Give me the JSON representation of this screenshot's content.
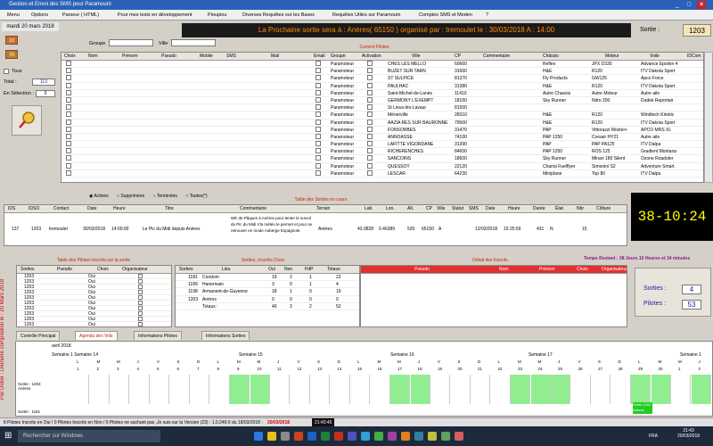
{
  "window": {
    "title": "Gestion et Envoi des SMS pour Paramoum",
    "min": "_",
    "max": "□",
    "close": "✕"
  },
  "menu": [
    "Menu",
    "Options",
    "Parseur ( HTML)",
    "Pour mes tests en développement",
    "Pioupiou",
    "Diverses Requêtes sur les Bases",
    "Requêtes Utiles sur Paramoum",
    "Comptes SMS et Moden",
    "?"
  ],
  "left": {
    "date": "mardi 20 mars 2018",
    "num1": "10",
    "num2": "79",
    "tous_label": "Tous",
    "total_label": "Total :",
    "total": "113",
    "selection_label": "En Sélection :",
    "selection": "0"
  },
  "filters": {
    "groupe_label": "Groupe",
    "ville_label": "Ville"
  },
  "banner": "La Prochaine sortie sera  à : Anères( 65150 ) organisé par : tremoulet le : 30/03/2018 A : 14:00",
  "sortie": {
    "label": "Sortie :",
    "value": "1203"
  },
  "pilots": {
    "title": "Current Pilotes",
    "headers": [
      "Choix",
      "Nom",
      "Prénom",
      "Pseudo",
      "Mobile",
      "SMS",
      "Mail",
      "Email",
      "Groupe",
      "Activation",
      "Ville",
      "CP",
      "Commentaire",
      "Châssis",
      "Moteur",
      "Voile",
      "IDCom"
    ],
    "rows": [
      [
        "Paramoteur",
        "CHES LES MELLO",
        "60660",
        "Reflex",
        "JPX D330",
        "Advance Epsilon 4"
      ],
      [
        "Paramoteur",
        "BUZET SUR TARN",
        "31660",
        "H&E",
        "R120",
        "ITV Dakota Sport"
      ],
      [
        "Paramoteur",
        "ST SULPICE",
        "81370",
        "Fly Products",
        "GW125",
        "Apco Force"
      ],
      [
        "Paramoteur",
        "PAULHAC",
        "31380",
        "H&E",
        "R120",
        "ITV Dakota Sport"
      ],
      [
        "Paramoteur",
        "Saint-Michel-de-Lanès",
        "11410",
        "Autre Chassis",
        "Autre Moteur",
        "Autre aile"
      ],
      [
        "Paramoteur",
        "GERMONY L'EXEMPT",
        "18150",
        "Sky Runner",
        "Nitro 200",
        "Dudek Reportair"
      ],
      [
        "Paramoteur",
        "St Lieux-lès-Lavaur",
        "81500",
        "",
        "",
        ""
      ],
      [
        "Paramoteur",
        "Ménerville",
        "28310",
        "H&E",
        "R120",
        "Windtech Kinetic"
      ],
      [
        "Paramoteur",
        "AAZIA RES SUR BAURONNE",
        "79500",
        "H&E",
        "R120",
        "ITV Dakota Sport"
      ],
      [
        "Paramoteur",
        "FONSORBES",
        "31470",
        "PAP",
        "Vittorazzi Moster+",
        "APCO  MRS XL"
      ],
      [
        "Paramoteur",
        "ANNOASSE",
        "74100",
        "PAP 1250",
        "Corsair HY21",
        "Autre aile"
      ],
      [
        "Paramoteur",
        "LAFITTE VIGORDANE",
        "31390",
        "PAP",
        "PAP PA125",
        "ITV Dalpa"
      ],
      [
        "Paramoteur",
        "RICHERENCHES",
        "84600",
        "PAP 1250",
        "ROS 125",
        "Gradient Montana"
      ],
      [
        "Paramoteur",
        "SANCOINS",
        "18600",
        "Sky Runner",
        "Minari 180 Silent",
        "Ozone Roadster"
      ],
      [
        "Paramoteur",
        "QUESSOY",
        "22120",
        "Charist Fuelflyer",
        "Simonini S2",
        "Adventure Smart"
      ],
      [
        "Paramoteur",
        "LESCAR",
        "64230",
        "Miniplane",
        "Top 80",
        "ITV Dalpa"
      ]
    ]
  },
  "status_radio": {
    "actives": "Actives",
    "supprimees": "Supprimées",
    "terminees": "Terminées",
    "toutes": "Toutes(*)"
  },
  "sorties": {
    "title": "Table des Sorties en cours",
    "headers": [
      "IDS",
      "IDSO",
      "Contact",
      "Date",
      "Heure",
      "Titre",
      "Commentaire",
      "Terrain",
      "Lati.",
      "Lon.",
      "Alt.",
      "CP",
      "Ville",
      "Statut",
      "SMS",
      "Date",
      "Heure",
      "Durée",
      "État",
      "Nbr",
      "Clôture"
    ],
    "row": [
      "137",
      "1203",
      "tremoulet",
      "30/03/2018",
      "14:00:00",
      "Le Pic du Midi depuis Anères",
      "WE de Pâques à Anères pour tenter le survol du Pic du Midi s'la météo le permet et pour se retrouver en mode Auberge Espagnole.",
      "Anères",
      "43.0828",
      "0.46389",
      "520",
      "65150",
      "A",
      "12/03/2018",
      "15:25:59",
      "431",
      "N",
      "15"
    ]
  },
  "clock": "38-10:24",
  "remaining": "Temps Restant : 38 Jours 10 Heures et 34 minutes",
  "inscrits": {
    "title": "Table des Pilotes Inscrits sur la sortie",
    "headers": [
      "Sorties",
      "Pseudo",
      "Choix",
      "Organisateur"
    ],
    "rows": [
      [
        "1203",
        "Oui"
      ],
      [
        "1203",
        "Oui"
      ],
      [
        "1203",
        "Oui"
      ],
      [
        "1203",
        "Oui"
      ],
      [
        "1203",
        "Oui"
      ],
      [
        "1203",
        "Oui"
      ],
      [
        "1203",
        "Oui"
      ],
      [
        "1203",
        "Oui"
      ],
      [
        "1203",
        "Oui"
      ],
      [
        "1203",
        "Oui"
      ],
      [
        "1203",
        "Oui"
      ]
    ]
  },
  "stats": {
    "title": "Sorties, Inscrits,Choix",
    "headers": [
      "Sorties",
      "Lieu",
      "Oui",
      "Non",
      "PdP",
      "Totaux"
    ],
    "rows": [
      [
        "1181",
        "Condom",
        "19",
        "2",
        "1",
        "22"
      ],
      [
        "1189",
        "Hanerivain",
        "3",
        "0",
        "1",
        "4"
      ],
      [
        "1198",
        "Armanent-de-Guyenne",
        "18",
        "1",
        "0",
        "19"
      ],
      [
        "1203",
        "Anères",
        "0",
        "0",
        "0",
        "0"
      ],
      [
        "",
        "Totaux :",
        "40",
        "3",
        "2",
        "52"
      ]
    ]
  },
  "detail": {
    "title": "Détail des Inscrits",
    "headers": [
      "Pseudo",
      "Nom",
      "Prénom",
      "Choix",
      "Organisateur"
    ]
  },
  "summary": {
    "sorties_label": "Sorties :",
    "sorties": "4",
    "pilotes_label": "Pilotes :",
    "pilotes": "53"
  },
  "sidebar_text": "Par Didier - Dernière compilation le : 20 Mars 2018",
  "tabs": [
    "Contrôle Principal",
    "Agenda des Vols",
    "Informations Pilotes",
    "Informations Sorties"
  ],
  "agenda": {
    "month": "avril 2018",
    "weeks": [
      "Semaine 1 Semaine 14",
      "Semaine 15",
      "Semaine 16",
      "Semaine 17",
      "Semaine 1"
    ],
    "days": [
      "L",
      "M",
      "M",
      "J",
      "V",
      "S",
      "D"
    ],
    "rowlabel1": "Sortie : 1203 Anères",
    "rowlabel2": "Sortie : 1181",
    "event": "Sortie 1181 Anères"
  },
  "statusbar": {
    "text": "8 Pilotes Inscrits en Oui / 0 Pilotes Inscrits en Non / 0 Pilotes ne sachant pas ,Je suis sur la Version (23) : 1.0.249.0 du 18/03/2018 :",
    "date": "20/03/2018",
    "time": "21:43:45"
  },
  "taskbar": {
    "search": "Rechercher sur Windows",
    "lang": "FRA",
    "clock_time": "21:43",
    "clock_date": "20/03/2018"
  }
}
